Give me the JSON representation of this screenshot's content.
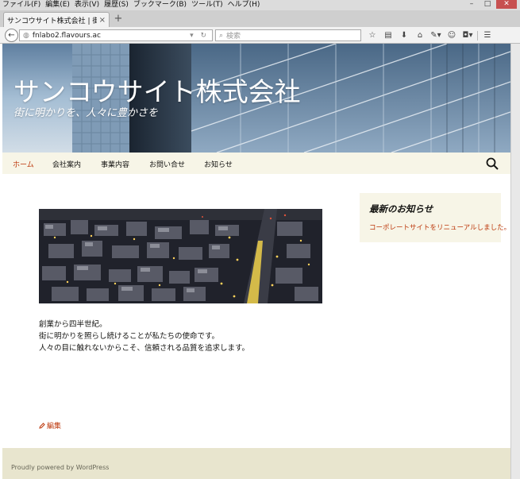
{
  "browser": {
    "menu": [
      "ファイル(F)",
      "編集(E)",
      "表示(V)",
      "履歴(S)",
      "ブックマーク(B)",
      "ツール(T)",
      "ヘルプ(H)"
    ],
    "tab_title": "サンコウサイト株式会社 | 街に明...",
    "tab_close": "×",
    "new_tab": "+",
    "url": "fnlabo2.flavours.ac",
    "search_placeholder": "検索"
  },
  "site": {
    "title": "サンコウサイト株式会社",
    "tagline": "街に明かりを、人々に豊かさを"
  },
  "nav": {
    "items": [
      "ホーム",
      "会社案内",
      "事業内容",
      "お問い合せ",
      "お知らせ"
    ],
    "active_index": 0
  },
  "content": {
    "lines": [
      "創業から四半世紀。",
      "街に明かりを照らし続けることが私たちの使命です。",
      "人々の目に触れないからこそ、信頼される品質を追求します。"
    ],
    "edit_label": "編集"
  },
  "sidebar": {
    "widget_title": "最新のお知らせ",
    "news_link": "コーポレートサイトをリニューアルしました。"
  },
  "footer": {
    "credit": "Proudly powered by WordPress"
  },
  "colors": {
    "accent": "#bc360a",
    "nav_bg": "#f7f5e7",
    "footer_bg": "#e8e5ce",
    "text": "#141412"
  }
}
